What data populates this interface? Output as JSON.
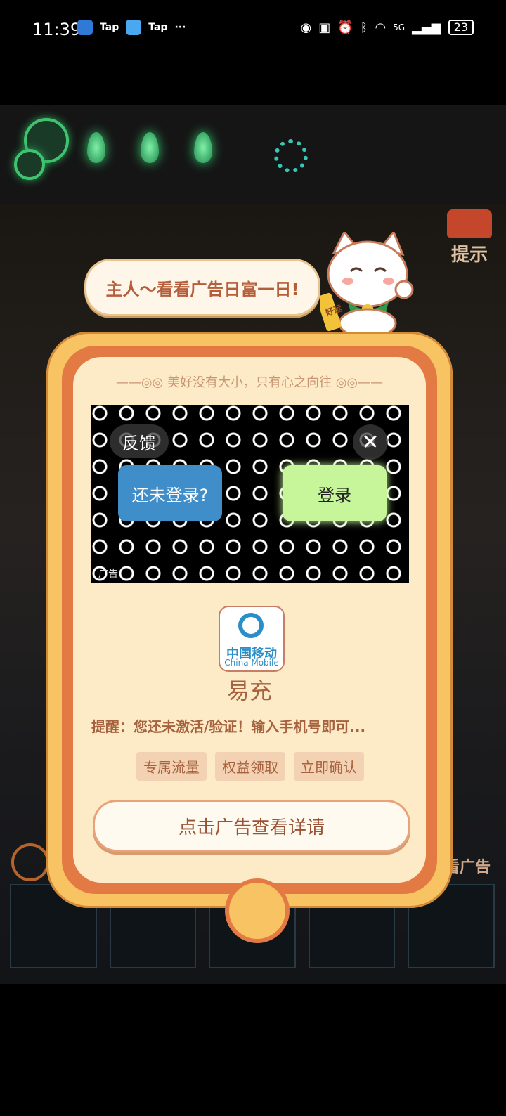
{
  "status_bar": {
    "time": "11:39",
    "left_labels": [
      "Tap",
      "Tap",
      "···"
    ],
    "network": "5G",
    "battery": "23"
  },
  "game": {
    "hint_label": "提示",
    "watch_ad_label": "看广告"
  },
  "bubble": {
    "text": "主人～看看广告日富一日!"
  },
  "cat": {
    "badge_text": "好运"
  },
  "ad_panel": {
    "motto": "美好没有大小，只有心之向往",
    "feedback_label": "反馈",
    "close_label": "✕",
    "ad_left_button": "还未登录?",
    "ad_right_button": "登录",
    "ad_tag": "广告",
    "app_logo": {
      "cn": "中国移动",
      "en": "China Mobile"
    },
    "app_name": "易充",
    "description": "提醒：您还未激活/验证！输入手机号即可...",
    "tags": [
      "专属流量",
      "权益领取",
      "立即确认"
    ],
    "cta_label": "点击广告查看详请"
  },
  "colors": {
    "frame_gold": "#f7c363",
    "frame_orange": "#e37a43",
    "panel_bg": "#fcebc6",
    "text_brown": "#a6613e"
  }
}
